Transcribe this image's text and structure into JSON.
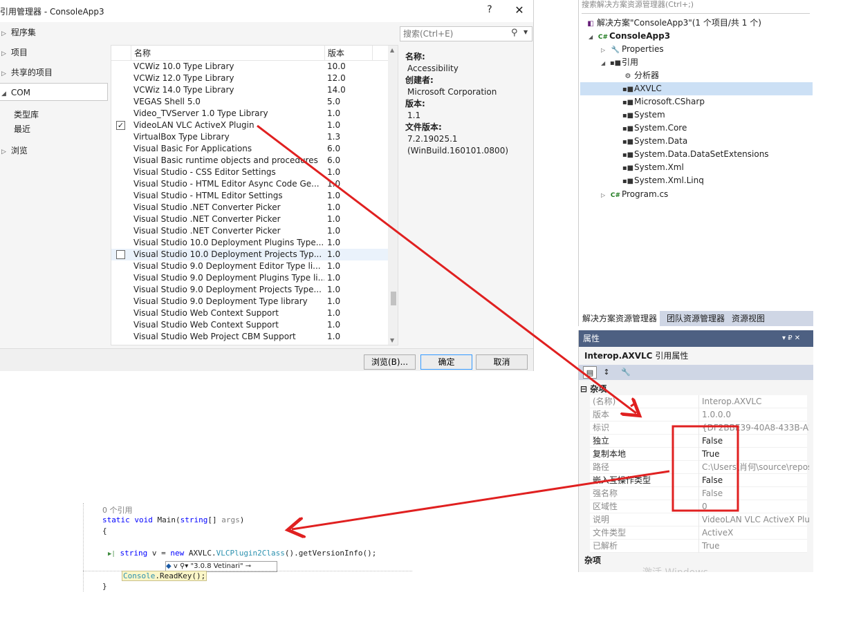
{
  "dialog": {
    "title": "引用管理器 - ConsoleApp3",
    "help": "?",
    "close": "✕",
    "nav": [
      {
        "label": "程序集",
        "arrow": "▷"
      },
      {
        "label": "项目",
        "arrow": "▷"
      },
      {
        "label": "共享的项目",
        "arrow": "▷"
      },
      {
        "label": "COM",
        "arrow": "◢"
      }
    ],
    "nav_sub": [
      "类型库",
      "最近"
    ],
    "nav_browse": {
      "label": "浏览",
      "arrow": "▷"
    },
    "columns": {
      "name": "名称",
      "version": "版本"
    },
    "rows": [
      {
        "name": "VCWiz 10.0 Type Library",
        "version": "10.0",
        "checkbox": false,
        "checked": false
      },
      {
        "name": "VCWiz 12.0 Type Library",
        "version": "12.0",
        "checkbox": false,
        "checked": false
      },
      {
        "name": "VCWiz 14.0 Type Library",
        "version": "14.0",
        "checkbox": false,
        "checked": false
      },
      {
        "name": "VEGAS Shell 5.0",
        "version": "5.0",
        "checkbox": false,
        "checked": false
      },
      {
        "name": "Video_TVServer 1.0 Type Library",
        "version": "1.0",
        "checkbox": false,
        "checked": false
      },
      {
        "name": "VideoLAN VLC ActiveX Plugin",
        "version": "1.0",
        "checkbox": true,
        "checked": true
      },
      {
        "name": "VirtualBox Type Library",
        "version": "1.3",
        "checkbox": false,
        "checked": false
      },
      {
        "name": "Visual Basic For Applications",
        "version": "6.0",
        "checkbox": false,
        "checked": false
      },
      {
        "name": "Visual Basic runtime objects and procedures",
        "version": "6.0",
        "checkbox": false,
        "checked": false
      },
      {
        "name": "Visual Studio - CSS Editor Settings",
        "version": "1.0",
        "checkbox": false,
        "checked": false
      },
      {
        "name": "Visual Studio - HTML Editor Async Code Ge...",
        "version": "1.0",
        "checkbox": false,
        "checked": false
      },
      {
        "name": "Visual Studio - HTML Editor Settings",
        "version": "1.0",
        "checkbox": false,
        "checked": false
      },
      {
        "name": "Visual Studio .NET Converter Picker",
        "version": "1.0",
        "checkbox": false,
        "checked": false
      },
      {
        "name": "Visual Studio .NET Converter Picker",
        "version": "1.0",
        "checkbox": false,
        "checked": false
      },
      {
        "name": "Visual Studio .NET Converter Picker",
        "version": "1.0",
        "checkbox": false,
        "checked": false
      },
      {
        "name": "Visual Studio 10.0 Deployment Plugins Type...",
        "version": "1.0",
        "checkbox": false,
        "checked": false
      },
      {
        "name": "Visual Studio 10.0 Deployment Projects Typ...",
        "version": "1.0",
        "checkbox": true,
        "checked": false,
        "highlight": true
      },
      {
        "name": "Visual Studio 9.0 Deployment Editor Type li...",
        "version": "1.0",
        "checkbox": false,
        "checked": false
      },
      {
        "name": "Visual Studio 9.0 Deployment Plugins Type li...",
        "version": "1.0",
        "checkbox": false,
        "checked": false
      },
      {
        "name": "Visual Studio 9.0 Deployment Projects Type...",
        "version": "1.0",
        "checkbox": false,
        "checked": false
      },
      {
        "name": "Visual Studio 9.0 Deployment Type library",
        "version": "1.0",
        "checkbox": false,
        "checked": false
      },
      {
        "name": "Visual Studio Web Context Support",
        "version": "1.0",
        "checkbox": false,
        "checked": false
      },
      {
        "name": "Visual Studio Web Context Support",
        "version": "1.0",
        "checkbox": false,
        "checked": false
      },
      {
        "name": "Visual Studio Web Project CBM Support",
        "version": "1.0",
        "checkbox": false,
        "checked": false
      }
    ],
    "search": {
      "placeholder": "搜索(Ctrl+E)",
      "icon": "search-icon"
    },
    "details": [
      {
        "label": "名称:",
        "value": "Accessibility"
      },
      {
        "label": "创建者:",
        "value": "Microsoft Corporation"
      },
      {
        "label": "版本:",
        "value": "1.1"
      },
      {
        "label": "文件版本:",
        "value": "7.2.19025.1"
      }
    ],
    "detail_extra": "(WinBuild.160101.0800)",
    "buttons": {
      "browse": "浏览(B)...",
      "ok": "确定",
      "cancel": "取消"
    }
  },
  "solution_explorer": {
    "search_hint": "搜索解决方案资源管理器(Ctrl+;)",
    "solution": "解决方案\"ConsoleApp3\"(1 个项目/共 1 个)",
    "project": "ConsoleApp3",
    "properties": "Properties",
    "references": "引用",
    "ref_items": [
      "分析器",
      "AXVLC",
      "Microsoft.CSharp",
      "System",
      "System.Core",
      "System.Data",
      "System.Data.DataSetExtensions",
      "System.Xml",
      "System.Xml.Linq"
    ],
    "program": "Program.cs",
    "tabs": [
      "解决方案资源管理器",
      "团队资源管理器",
      "资源视图"
    ]
  },
  "properties": {
    "title": "属性",
    "controls": "▾ ₽ ✕",
    "object": "Interop.AXVLC",
    "object_suffix": "引用属性",
    "category": "杂项",
    "rows": [
      {
        "name": "(名称)",
        "value": "Interop.AXVLC",
        "grey": true
      },
      {
        "name": "版本",
        "value": "1.0.0.0",
        "grey": true
      },
      {
        "name": "标识",
        "value": "{DF2BBE39-40A8-433B-A27",
        "grey": true
      },
      {
        "name": "独立",
        "value": "False",
        "grey": false
      },
      {
        "name": "复制本地",
        "value": "True",
        "grey": false
      },
      {
        "name": "路径",
        "value": "C:\\Users\\肖何\\source\\repos",
        "grey": true
      },
      {
        "name": "嵌入互操作类型",
        "value": "False",
        "grey": false
      },
      {
        "name": "强名称",
        "value": "False",
        "grey": true
      },
      {
        "name": "区域性",
        "value": "0",
        "grey": true
      },
      {
        "name": "说明",
        "value": "VideoLAN VLC ActiveX Plug",
        "grey": true
      },
      {
        "name": "文件类型",
        "value": "ActiveX",
        "grey": true
      },
      {
        "name": "已解析",
        "value": "True",
        "grey": true
      }
    ],
    "desc_title": "杂项",
    "watermark": "激活 Windows"
  },
  "code": {
    "refcount": "0 个引用",
    "line1": {
      "kw1": "static",
      "kw2": "void",
      "rest": " Main(",
      "kw3": "string",
      "rest2": "[] ",
      "arg": "args",
      "close": ")"
    },
    "open": "{",
    "line3": {
      "kw1": "string",
      "var": " v",
      "eq": " = ",
      "kw2": "new",
      "ns": " AXVLC.",
      "cls": "VLCPlugin2Class",
      "rest": "().getVersionInfo();"
    },
    "datatip": {
      "var": "v",
      "value": "\"3.0.8 Vetinari\""
    },
    "line4": {
      "cls": "Console",
      "rest": ".ReadKey();"
    },
    "close": "}"
  },
  "colors": {
    "arrow": "#e02020",
    "box": "#e02020",
    "selection": "#cce0f5",
    "title_bar": "#4d6082"
  }
}
